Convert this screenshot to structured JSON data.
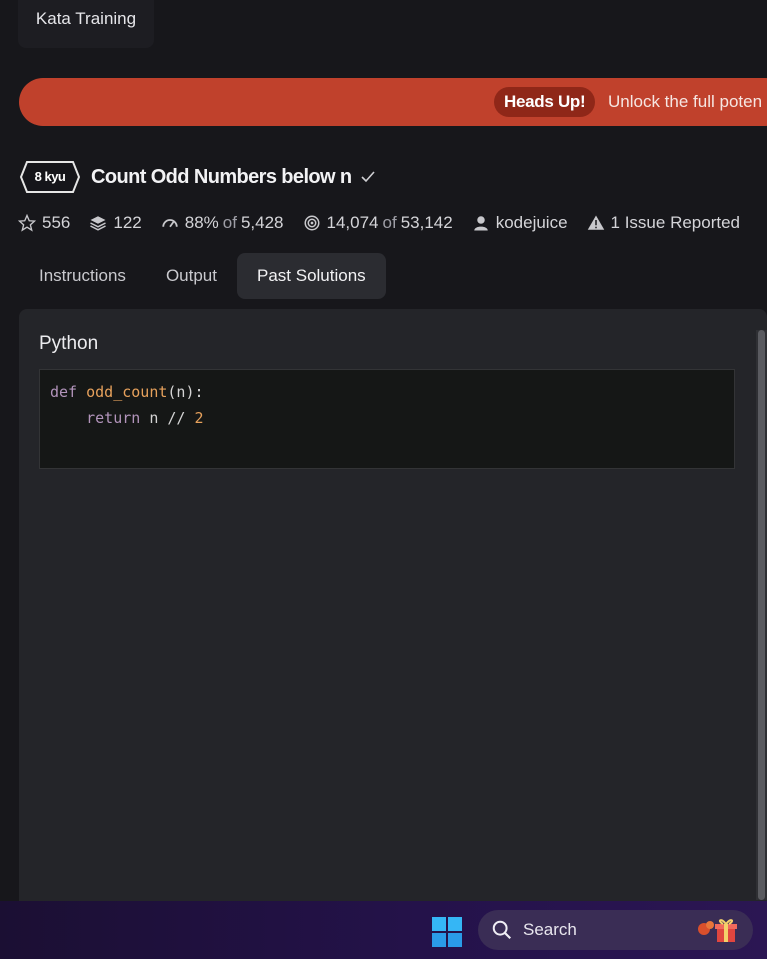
{
  "header": {
    "kata_training_tab": "Kata Training"
  },
  "banner": {
    "badge": "Heads Up!",
    "message": "Unlock the full poten"
  },
  "kata": {
    "rank": "8 kyu",
    "title": "Count Odd Numbers below n",
    "stats": {
      "stars": "556",
      "collections": "122",
      "satisfaction_percent": "88%",
      "satisfaction_of": "of",
      "satisfaction_total": "5,428",
      "completed": "14,074",
      "completed_of": "of",
      "attempted": "53,142",
      "author": "kodejuice",
      "issues": "1 Issue Reported"
    }
  },
  "tabs": [
    {
      "label": "Instructions",
      "active": false
    },
    {
      "label": "Output",
      "active": false
    },
    {
      "label": "Past Solutions",
      "active": true
    }
  ],
  "solution": {
    "language": "Python",
    "code": {
      "line1_kw": "def",
      "line1_fn": "odd_count",
      "line1_rest": "(n):",
      "line2_indent": "    ",
      "line2_kw": "return",
      "line2_rest": " n // ",
      "line2_num": "2"
    }
  },
  "taskbar": {
    "search_label": "Search"
  },
  "colors": {
    "banner": "#c0412c",
    "badge": "#8f2718",
    "panel": "#242529",
    "background": "#17171b"
  },
  "icons": [
    "star-icon",
    "layers-icon",
    "gauge-icon",
    "target-icon",
    "user-icon",
    "warning-icon",
    "check-icon",
    "windows-start-icon",
    "search-icon",
    "gift-icon"
  ]
}
